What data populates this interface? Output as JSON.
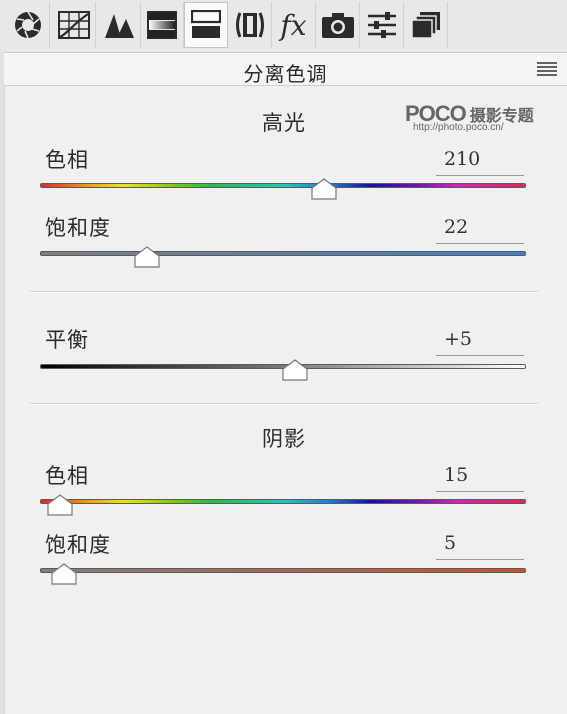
{
  "toolbar": {
    "tools": [
      {
        "icon": "aperture-icon"
      },
      {
        "icon": "tone-curve-icon"
      },
      {
        "icon": "detail-mountains-icon"
      },
      {
        "icon": "hsl-gradient-icon"
      },
      {
        "icon": "split-toning-icon",
        "active": true
      },
      {
        "icon": "lens-corrections-icon"
      },
      {
        "icon": "fx-effects-icon"
      },
      {
        "icon": "camera-calibration-icon"
      },
      {
        "icon": "presets-sliders-icon"
      },
      {
        "icon": "snapshots-icon"
      }
    ],
    "fx_label": "fx"
  },
  "panel": {
    "title": "分离色调"
  },
  "watermark": {
    "logo": "POCO",
    "brand": "摄影专题",
    "url": "http://photo.poco.cn/"
  },
  "highlights": {
    "title": "高光",
    "hue": {
      "label": "色相",
      "value": "210",
      "level": 210,
      "max": 360
    },
    "saturation": {
      "label": "饱和度",
      "value": "22",
      "level": 22,
      "max": 100,
      "color": "#3c80cc"
    }
  },
  "balance": {
    "label": "平衡",
    "value": "+5",
    "level": 5,
    "min": -100,
    "max": 100
  },
  "shadows": {
    "title": "阴影",
    "hue": {
      "label": "色相",
      "value": "15",
      "level": 15,
      "max": 360
    },
    "saturation": {
      "label": "饱和度",
      "value": "5",
      "level": 5,
      "max": 100,
      "color": "#c8532a"
    }
  }
}
